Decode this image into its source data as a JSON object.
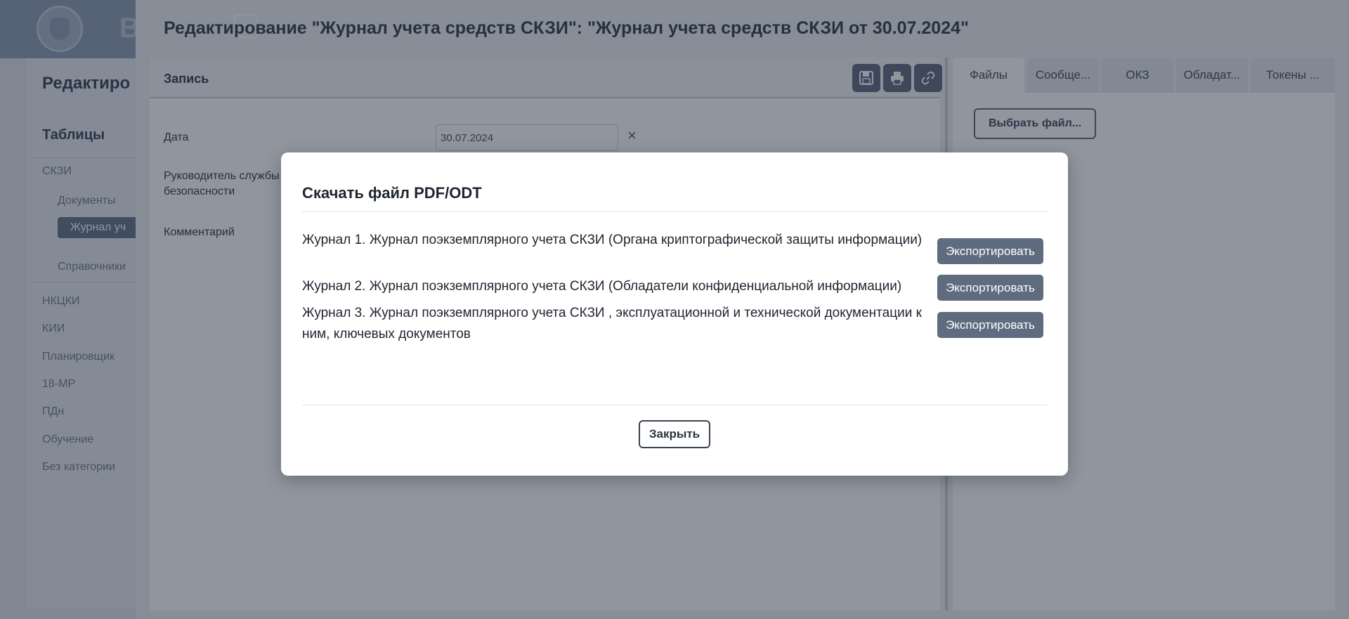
{
  "app": {
    "logo_text": "В"
  },
  "sidebar": {
    "title": "Редактиро",
    "section": "Таблицы",
    "items": [
      "СКЗИ",
      "Документы",
      "Журнал уч",
      "Справочники",
      "НКЦКИ",
      "КИИ",
      "Планировщик",
      "18-МР",
      "ПДн",
      "Обучение",
      "Без категории"
    ]
  },
  "drawer": {
    "title": "Редактирование \"Журнал учета средств СКЗИ\": \"Журнал учета средств СКЗИ от 30.07.2024\"",
    "close_icon": "×"
  },
  "record": {
    "header": "Запись",
    "toolbar_icons": [
      "save-icon",
      "print-icon",
      "link-icon"
    ],
    "fields": {
      "date_label": "Дата",
      "date_value": "30.07.2024",
      "clear_icon": "×",
      "head_label": "Руководитель службы безопасности",
      "comment_label": "Комментарий"
    }
  },
  "right_panel": {
    "tabs": [
      "Файлы",
      "Сообще...",
      "ОКЗ",
      "Обладат...",
      "Токены ..."
    ],
    "file_button": "Выбрать файл..."
  },
  "modal": {
    "title": "Скачать файл PDF/ODT",
    "reports": [
      {
        "label": "Журнал 1. Журнал поэкземплярного учета СКЗИ (Органа криптографической защиты информации)",
        "button": "Экспортировать"
      },
      {
        "label": "Журнал 2. Журнал поэкземплярного учета СКЗИ (Обладатели конфиденциальной информации)",
        "button": "Экспортировать"
      },
      {
        "label": "Журнал 3. Журнал поэкземплярного учета СКЗИ , эксплуатационной и технической документации к ним, ключевых документов",
        "button": "Экспортировать"
      }
    ],
    "close_button": "Закрыть"
  }
}
